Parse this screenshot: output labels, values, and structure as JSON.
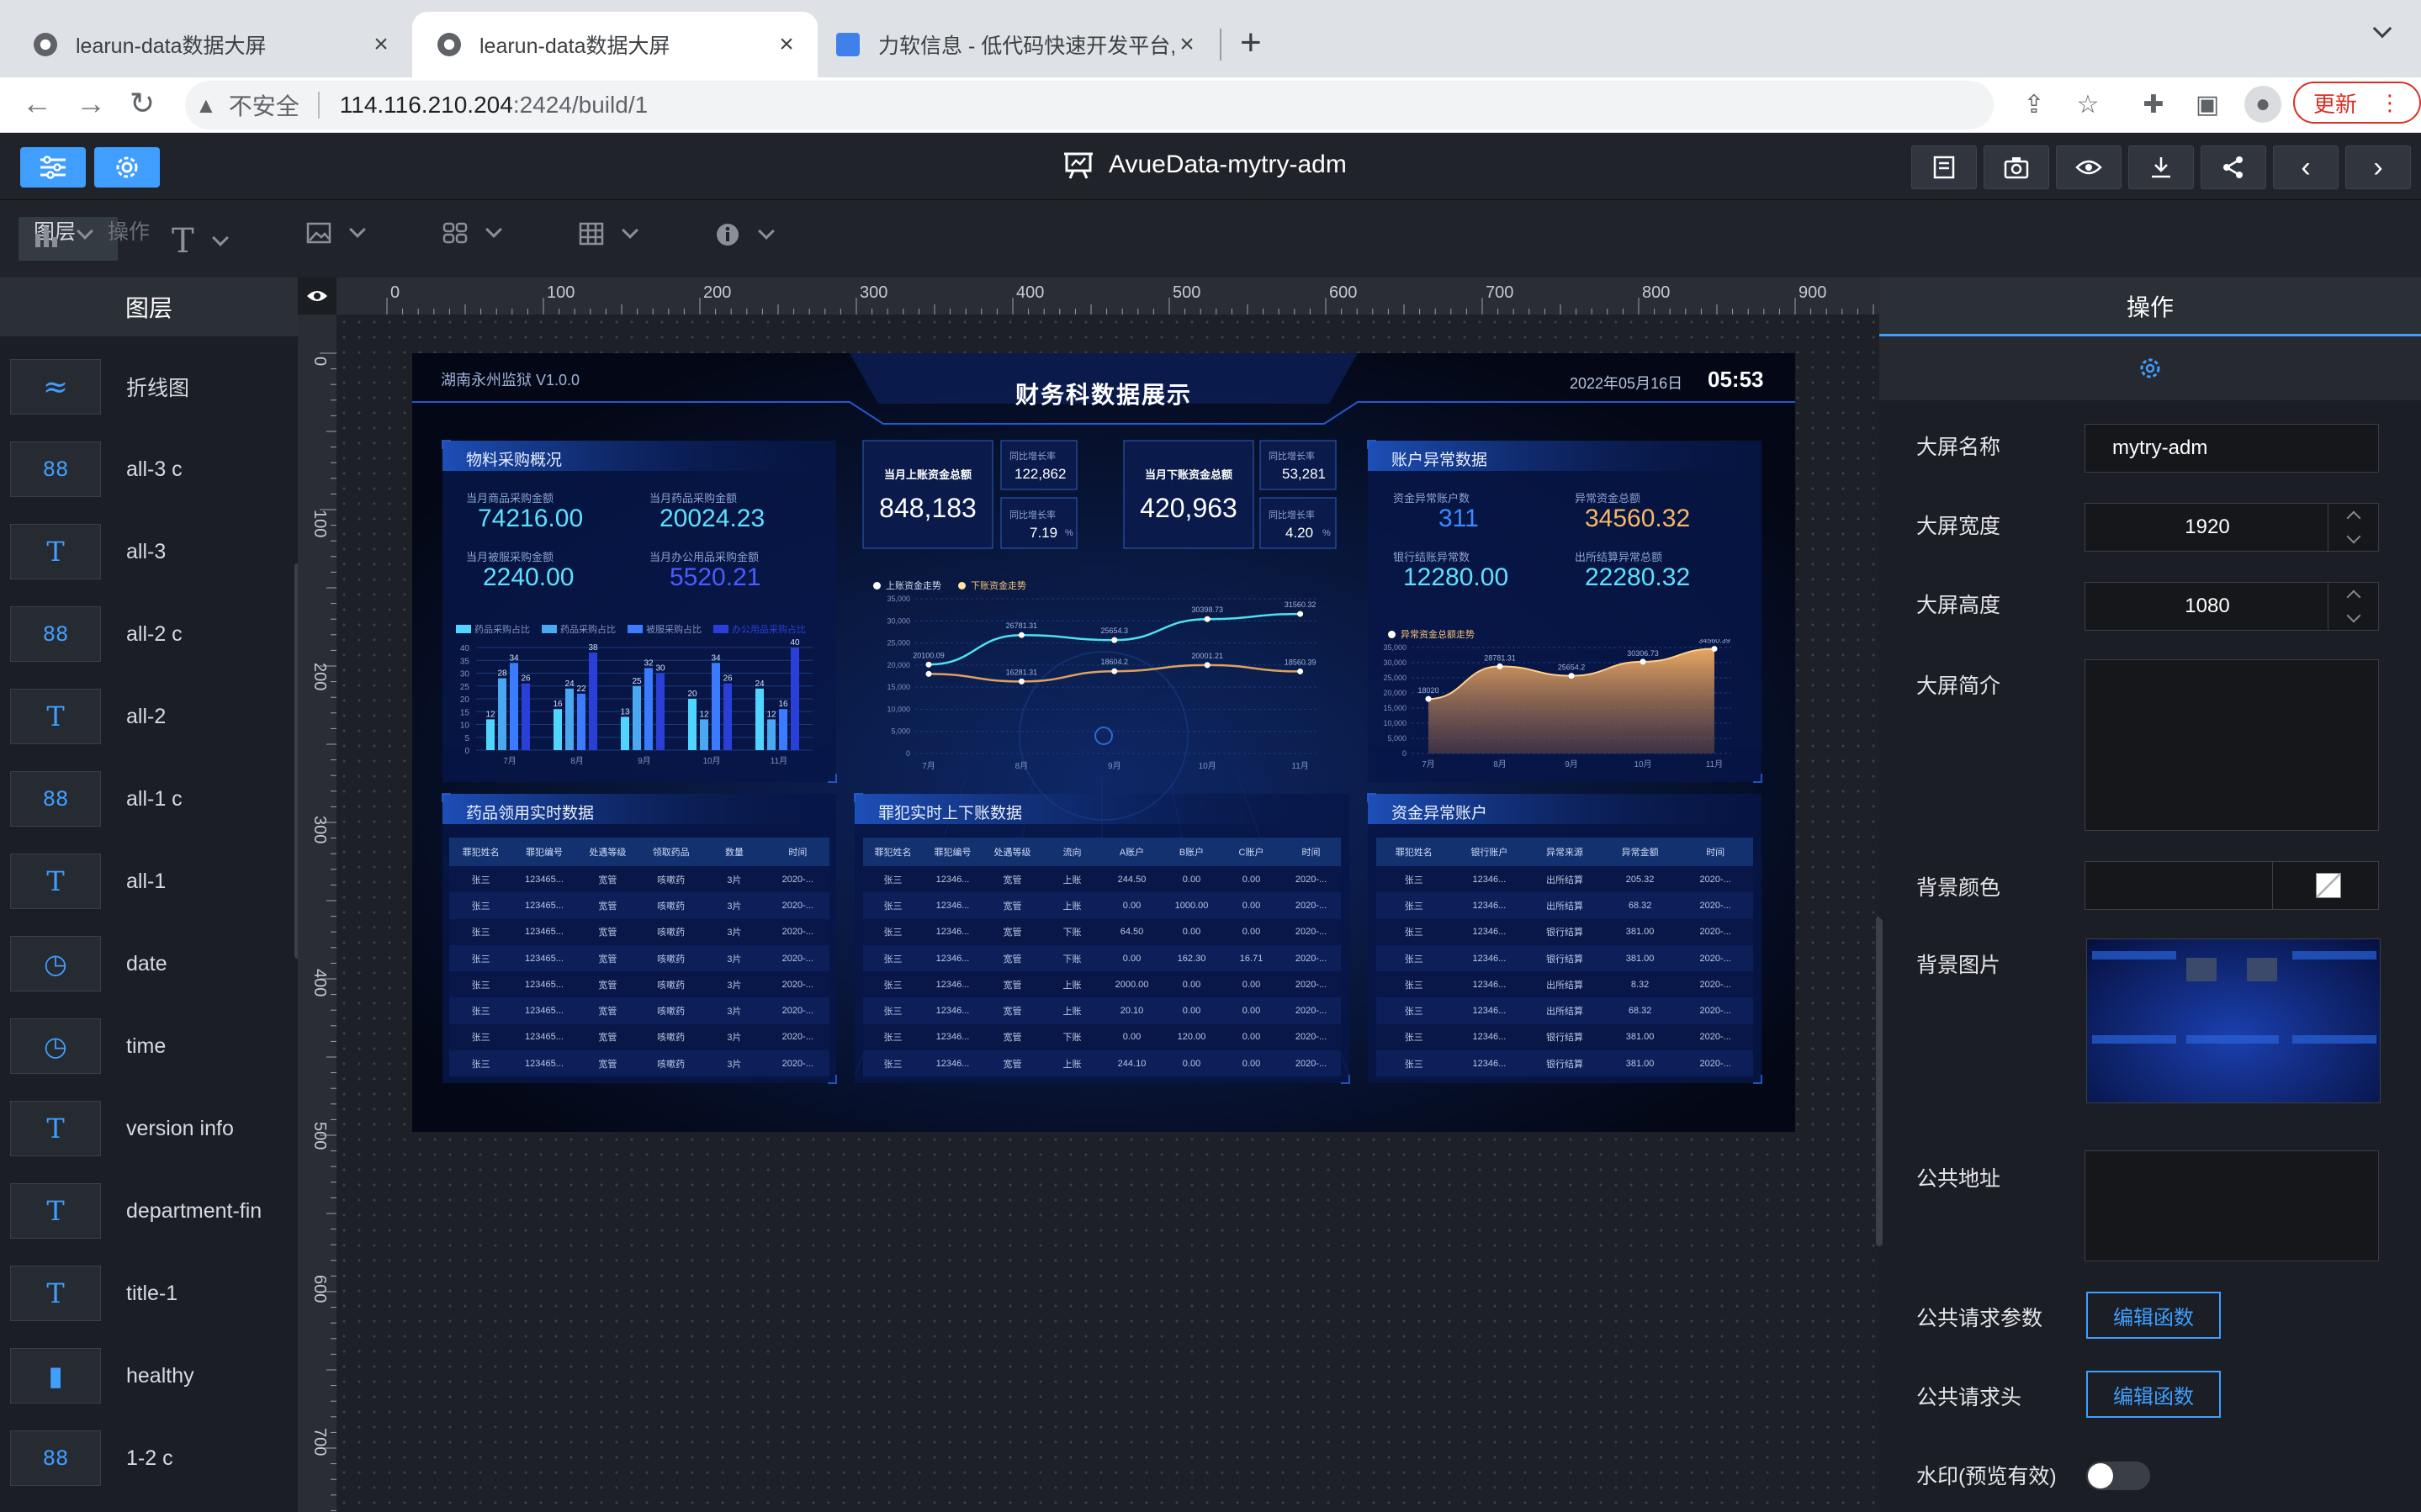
{
  "browser": {
    "tabs": [
      {
        "title": "learun-data数据大屏"
      },
      {
        "title": "learun-data数据大屏"
      },
      {
        "title": "力软信息 - 低代码快速开发平台,"
      }
    ],
    "address": {
      "security": "不安全",
      "host": "114.116.210.204",
      "rest": ":2424/build/1"
    },
    "update_label": "更新"
  },
  "app": {
    "title": "AvueData-mytry-adm",
    "left_tabs": [
      "图层",
      "操作"
    ],
    "layers_header": "图层",
    "ops_header": "操作",
    "layers": [
      {
        "icon": "line-chart-icon",
        "name": "折线图"
      },
      {
        "icon": "grid-icon",
        "name": "all-3 c"
      },
      {
        "icon": "text-icon",
        "name": "all-3"
      },
      {
        "icon": "grid-icon",
        "name": "all-2 c"
      },
      {
        "icon": "text-icon",
        "name": "all-2"
      },
      {
        "icon": "grid-icon",
        "name": "all-1 c"
      },
      {
        "icon": "text-icon",
        "name": "all-1"
      },
      {
        "icon": "clock-icon",
        "name": "date"
      },
      {
        "icon": "clock-icon",
        "name": "time"
      },
      {
        "icon": "text-icon",
        "name": "version info"
      },
      {
        "icon": "text-icon",
        "name": "department-fin"
      },
      {
        "icon": "text-icon",
        "name": "title-1"
      },
      {
        "icon": "bar-chart-icon",
        "name": "healthy"
      },
      {
        "icon": "grid-icon",
        "name": "1-2 c"
      }
    ],
    "rulers": {
      "top": [
        "0",
        "100",
        "200",
        "300",
        "400",
        "500",
        "600",
        "700",
        "800",
        "900"
      ],
      "left": [
        "0",
        "100",
        "200",
        "300",
        "400",
        "500",
        "600",
        "700"
      ]
    },
    "form": {
      "name_label": "大屏名称",
      "name_value": "mytry-adm",
      "width_label": "大屏宽度",
      "width_value": "1920",
      "height_label": "大屏高度",
      "height_value": "1080",
      "intro_label": "大屏简介",
      "bgcolor_label": "背景颜色",
      "bgimage_label": "背景图片",
      "public_url_label": "公共地址",
      "req_params_label": "公共请求参数",
      "req_header_label": "公共请求头",
      "edit_fn_label": "编辑函数",
      "watermark_label": "水印(预览有效)"
    }
  },
  "dashboard": {
    "org": "湖南永州监狱 V1.0.0",
    "title": "财务科数据展示",
    "date": "2022年05月16日",
    "time": "05:53",
    "p1": {
      "title": "物料采购概况",
      "stats": [
        {
          "label": "当月商品采购金额",
          "value": "74216.00"
        },
        {
          "label": "当月药品采购金额",
          "value": "20024.23"
        },
        {
          "label": "当月被服采购金额",
          "value": "2240.00"
        },
        {
          "label": "当月办公用品采购金额",
          "value": "5520.21"
        }
      ],
      "legend": [
        "药品采购占比",
        "药品采购占比",
        "被服采购占比",
        "办公用品采购占比"
      ]
    },
    "center": {
      "in_label": "当月上账资金总额",
      "in_value": "848,183",
      "in_yoy_label": "同比增长率",
      "in_yoy": "122,862",
      "in_mom_label": "同比增长率",
      "in_mom": "7.19",
      "out_label": "当月下账资金总额",
      "out_value": "420,963",
      "out_yoy_label": "同比增长率",
      "out_yoy": "53,281",
      "out_mom_label": "同比增长率",
      "out_mom": "4.20",
      "pct": "%",
      "legend_a": "上账资金走势",
      "legend_b": "下账资金走势"
    },
    "p3": {
      "title": "账户异常数据",
      "stats": [
        {
          "label": "资金异常账户数",
          "value": "311"
        },
        {
          "label": "异常资金总额",
          "value": "34560.32"
        },
        {
          "label": "银行结账异常数",
          "value": "12280.00"
        },
        {
          "label": "出所结算异常总额",
          "value": "22280.32"
        }
      ],
      "legend": "异常资金总额走势"
    },
    "t1": {
      "title": "药品领用实时数据",
      "headers": [
        "罪犯姓名",
        "罪犯编号",
        "处遇等级",
        "领取药品",
        "数量",
        "时间"
      ],
      "rows": [
        [
          "张三",
          "123465...",
          "宽管",
          "咳嗽药",
          "3片",
          "2020-..."
        ],
        [
          "张三",
          "123465...",
          "宽管",
          "咳嗽药",
          "3片",
          "2020-..."
        ],
        [
          "张三",
          "123465...",
          "宽管",
          "咳嗽药",
          "3片",
          "2020-..."
        ],
        [
          "张三",
          "123465...",
          "宽管",
          "咳嗽药",
          "3片",
          "2020-..."
        ],
        [
          "张三",
          "123465...",
          "宽管",
          "咳嗽药",
          "3片",
          "2020-..."
        ],
        [
          "张三",
          "123465...",
          "宽管",
          "咳嗽药",
          "3片",
          "2020-..."
        ],
        [
          "张三",
          "123465...",
          "宽管",
          "咳嗽药",
          "3片",
          "2020-..."
        ],
        [
          "张三",
          "123465...",
          "宽管",
          "咳嗽药",
          "3片",
          "2020-..."
        ]
      ]
    },
    "t2": {
      "title": "罪犯实时上下账数据",
      "headers": [
        "罪犯姓名",
        "罪犯编号",
        "处遇等级",
        "流向",
        "A账户",
        "B账户",
        "C账户",
        "时间"
      ],
      "rows": [
        [
          "张三",
          "12346...",
          "宽管",
          "上账",
          "244.50",
          "0.00",
          "0.00",
          "2020-..."
        ],
        [
          "张三",
          "12346...",
          "宽管",
          "上账",
          "0.00",
          "1000.00",
          "0.00",
          "2020-..."
        ],
        [
          "张三",
          "12346...",
          "宽管",
          "下账",
          "64.50",
          "0.00",
          "0.00",
          "2020-..."
        ],
        [
          "张三",
          "12346...",
          "宽管",
          "下账",
          "0.00",
          "162.30",
          "16.71",
          "2020-..."
        ],
        [
          "张三",
          "12346...",
          "宽管",
          "上账",
          "2000.00",
          "0.00",
          "0.00",
          "2020-..."
        ],
        [
          "张三",
          "12346...",
          "宽管",
          "上账",
          "20.10",
          "0.00",
          "0.00",
          "2020-..."
        ],
        [
          "张三",
          "12346...",
          "宽管",
          "下账",
          "0.00",
          "120.00",
          "0.00",
          "2020-..."
        ],
        [
          "张三",
          "12346...",
          "宽管",
          "上账",
          "244.10",
          "0.00",
          "0.00",
          "2020-..."
        ]
      ]
    },
    "t3": {
      "title": "资金异常账户",
      "headers": [
        "罪犯姓名",
        "银行账户",
        "异常来源",
        "异常金额",
        "时间"
      ],
      "rows": [
        [
          "张三",
          "12346...",
          "出所结算",
          "205.32",
          "2020-..."
        ],
        [
          "张三",
          "12346...",
          "出所结算",
          "68.32",
          "2020-..."
        ],
        [
          "张三",
          "12346...",
          "银行结算",
          "381.00",
          "2020-..."
        ],
        [
          "张三",
          "12346...",
          "银行结算",
          "381.00",
          "2020-..."
        ],
        [
          "张三",
          "12346...",
          "出所结算",
          "8.32",
          "2020-..."
        ],
        [
          "张三",
          "12346...",
          "出所结算",
          "68.32",
          "2020-..."
        ],
        [
          "张三",
          "12346...",
          "银行结算",
          "381.00",
          "2020-..."
        ],
        [
          "张三",
          "12346...",
          "银行结算",
          "381.00",
          "2020-..."
        ]
      ]
    }
  },
  "chart_data": [
    {
      "type": "bar",
      "categories": [
        "7月",
        "8月",
        "9月",
        "10月",
        "11月"
      ],
      "series": [
        {
          "name": "药品采购占比",
          "values": [
            12,
            16,
            13,
            20,
            24
          ]
        },
        {
          "name": "药品采购占比",
          "values": [
            28,
            24,
            25,
            12,
            12
          ]
        },
        {
          "name": "被服采购占比",
          "values": [
            34,
            22,
            32,
            34,
            16
          ]
        },
        {
          "name": "办公用品采购占比",
          "values": [
            26,
            38,
            30,
            26,
            40
          ]
        }
      ],
      "ylim": [
        0,
        40
      ],
      "yticks": [
        "0",
        "5",
        "10",
        "15",
        "20",
        "25",
        "30",
        "35",
        "40"
      ]
    },
    {
      "type": "line",
      "categories": [
        "7月",
        "8月",
        "9月",
        "10月",
        "11月"
      ],
      "series": [
        {
          "name": "上账资金走势",
          "values": [
            20100.09,
            26781.31,
            25654.3,
            30398.73,
            31560.32
          ]
        },
        {
          "name": "下账资金走势",
          "values": [
            18000,
            16281.31,
            18604.2,
            20001.21,
            18560.39
          ]
        }
      ],
      "point_labels_a": [
        "20100.09",
        "26781.31",
        "25654.3",
        "30398.73",
        "31560.32"
      ],
      "point_labels_b": [
        "",
        "16281.31",
        "18604.2",
        "20001.21",
        "18560.39"
      ],
      "ylim": [
        0,
        35000
      ],
      "yticks": [
        "0",
        "5,000",
        "10,000",
        "15,000",
        "20,000",
        "25,000",
        "30,000",
        "35,000"
      ]
    },
    {
      "type": "area",
      "categories": [
        "7月",
        "8月",
        "9月",
        "10月",
        "11月"
      ],
      "series": [
        {
          "name": "异常资金总额走势",
          "values": [
            18020,
            28781.31,
            25654.2,
            30306.73,
            34560.39
          ]
        }
      ],
      "point_labels": [
        "18020",
        "28781.31",
        "25654.2",
        "30306.73",
        "34560.39"
      ],
      "ylim": [
        0,
        35000
      ],
      "yticks": [
        "0",
        "5,000",
        "10,000",
        "15,000",
        "20,000",
        "25,000",
        "30,000",
        "35,000"
      ]
    }
  ]
}
